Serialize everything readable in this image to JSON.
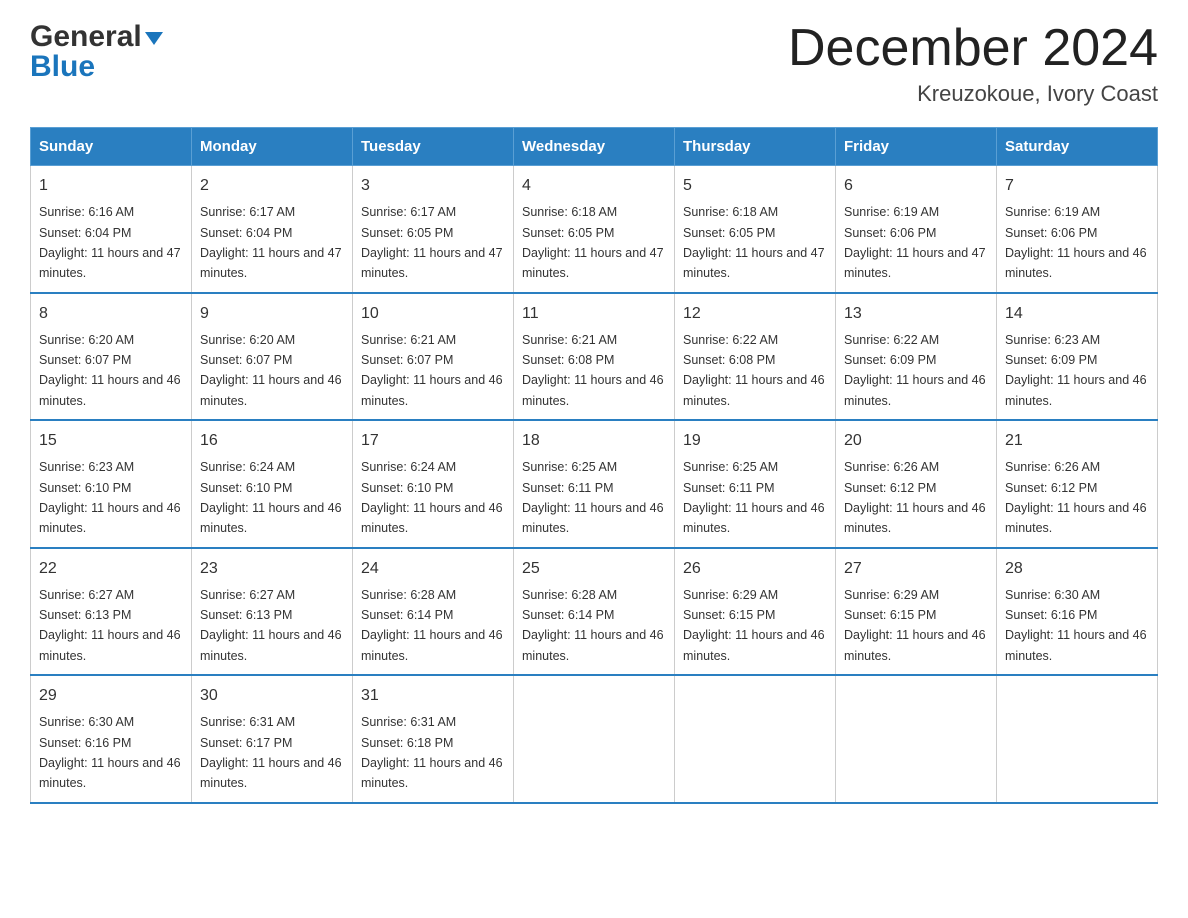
{
  "logo": {
    "line1": "General",
    "line2": "Blue"
  },
  "title": {
    "month_year": "December 2024",
    "location": "Kreuzokoue, Ivory Coast"
  },
  "headers": [
    "Sunday",
    "Monday",
    "Tuesday",
    "Wednesday",
    "Thursday",
    "Friday",
    "Saturday"
  ],
  "weeks": [
    [
      {
        "day": "1",
        "sunrise": "6:16 AM",
        "sunset": "6:04 PM",
        "daylight": "11 hours and 47 minutes."
      },
      {
        "day": "2",
        "sunrise": "6:17 AM",
        "sunset": "6:04 PM",
        "daylight": "11 hours and 47 minutes."
      },
      {
        "day": "3",
        "sunrise": "6:17 AM",
        "sunset": "6:05 PM",
        "daylight": "11 hours and 47 minutes."
      },
      {
        "day": "4",
        "sunrise": "6:18 AM",
        "sunset": "6:05 PM",
        "daylight": "11 hours and 47 minutes."
      },
      {
        "day": "5",
        "sunrise": "6:18 AM",
        "sunset": "6:05 PM",
        "daylight": "11 hours and 47 minutes."
      },
      {
        "day": "6",
        "sunrise": "6:19 AM",
        "sunset": "6:06 PM",
        "daylight": "11 hours and 47 minutes."
      },
      {
        "day": "7",
        "sunrise": "6:19 AM",
        "sunset": "6:06 PM",
        "daylight": "11 hours and 46 minutes."
      }
    ],
    [
      {
        "day": "8",
        "sunrise": "6:20 AM",
        "sunset": "6:07 PM",
        "daylight": "11 hours and 46 minutes."
      },
      {
        "day": "9",
        "sunrise": "6:20 AM",
        "sunset": "6:07 PM",
        "daylight": "11 hours and 46 minutes."
      },
      {
        "day": "10",
        "sunrise": "6:21 AM",
        "sunset": "6:07 PM",
        "daylight": "11 hours and 46 minutes."
      },
      {
        "day": "11",
        "sunrise": "6:21 AM",
        "sunset": "6:08 PM",
        "daylight": "11 hours and 46 minutes."
      },
      {
        "day": "12",
        "sunrise": "6:22 AM",
        "sunset": "6:08 PM",
        "daylight": "11 hours and 46 minutes."
      },
      {
        "day": "13",
        "sunrise": "6:22 AM",
        "sunset": "6:09 PM",
        "daylight": "11 hours and 46 minutes."
      },
      {
        "day": "14",
        "sunrise": "6:23 AM",
        "sunset": "6:09 PM",
        "daylight": "11 hours and 46 minutes."
      }
    ],
    [
      {
        "day": "15",
        "sunrise": "6:23 AM",
        "sunset": "6:10 PM",
        "daylight": "11 hours and 46 minutes."
      },
      {
        "day": "16",
        "sunrise": "6:24 AM",
        "sunset": "6:10 PM",
        "daylight": "11 hours and 46 minutes."
      },
      {
        "day": "17",
        "sunrise": "6:24 AM",
        "sunset": "6:10 PM",
        "daylight": "11 hours and 46 minutes."
      },
      {
        "day": "18",
        "sunrise": "6:25 AM",
        "sunset": "6:11 PM",
        "daylight": "11 hours and 46 minutes."
      },
      {
        "day": "19",
        "sunrise": "6:25 AM",
        "sunset": "6:11 PM",
        "daylight": "11 hours and 46 minutes."
      },
      {
        "day": "20",
        "sunrise": "6:26 AM",
        "sunset": "6:12 PM",
        "daylight": "11 hours and 46 minutes."
      },
      {
        "day": "21",
        "sunrise": "6:26 AM",
        "sunset": "6:12 PM",
        "daylight": "11 hours and 46 minutes."
      }
    ],
    [
      {
        "day": "22",
        "sunrise": "6:27 AM",
        "sunset": "6:13 PM",
        "daylight": "11 hours and 46 minutes."
      },
      {
        "day": "23",
        "sunrise": "6:27 AM",
        "sunset": "6:13 PM",
        "daylight": "11 hours and 46 minutes."
      },
      {
        "day": "24",
        "sunrise": "6:28 AM",
        "sunset": "6:14 PM",
        "daylight": "11 hours and 46 minutes."
      },
      {
        "day": "25",
        "sunrise": "6:28 AM",
        "sunset": "6:14 PM",
        "daylight": "11 hours and 46 minutes."
      },
      {
        "day": "26",
        "sunrise": "6:29 AM",
        "sunset": "6:15 PM",
        "daylight": "11 hours and 46 minutes."
      },
      {
        "day": "27",
        "sunrise": "6:29 AM",
        "sunset": "6:15 PM",
        "daylight": "11 hours and 46 minutes."
      },
      {
        "day": "28",
        "sunrise": "6:30 AM",
        "sunset": "6:16 PM",
        "daylight": "11 hours and 46 minutes."
      }
    ],
    [
      {
        "day": "29",
        "sunrise": "6:30 AM",
        "sunset": "6:16 PM",
        "daylight": "11 hours and 46 minutes."
      },
      {
        "day": "30",
        "sunrise": "6:31 AM",
        "sunset": "6:17 PM",
        "daylight": "11 hours and 46 minutes."
      },
      {
        "day": "31",
        "sunrise": "6:31 AM",
        "sunset": "6:18 PM",
        "daylight": "11 hours and 46 minutes."
      },
      null,
      null,
      null,
      null
    ]
  ]
}
